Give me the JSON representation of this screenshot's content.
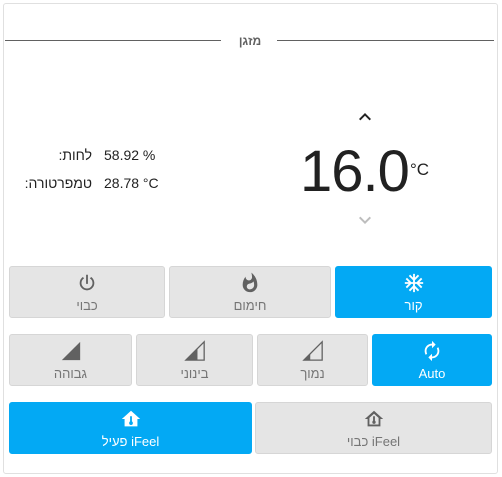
{
  "card": {
    "title": "מזגן"
  },
  "readings": {
    "humidity_label": "לחות:",
    "humidity_value": "58.92 %",
    "temperature_label": "טמפרטורה:",
    "temperature_value": "28.78 °C"
  },
  "thermostat": {
    "target": "16.0",
    "unit": "°C"
  },
  "modes": {
    "off_label": "כבוי",
    "heat_label": "חימום",
    "cool_label": "קור",
    "active": "cool"
  },
  "fan": {
    "high_label": "גבוהה",
    "medium_label": "בינוני",
    "low_label": "נמוך",
    "auto_label": "Auto",
    "active": "auto"
  },
  "ifeel": {
    "off_label": "כבוי iFeel",
    "on_label": "פעיל iFeel",
    "active": "on"
  },
  "colors": {
    "accent": "#03a9f4",
    "inactive_bg": "#e5e5e5",
    "inactive_text": "#757575"
  },
  "icons": {
    "up": "chevron-up-icon",
    "down": "chevron-down-icon",
    "power": "power-icon",
    "fire": "fire-icon",
    "snowflake": "snowflake-icon",
    "fan_high": "signal-full-icon",
    "fan_medium": "signal-medium-icon",
    "fan_low": "signal-low-icon",
    "fan_auto": "autorenew-icon",
    "ifeel_on": "home-thermometer-filled-icon",
    "ifeel_off": "home-thermometer-outline-icon"
  }
}
